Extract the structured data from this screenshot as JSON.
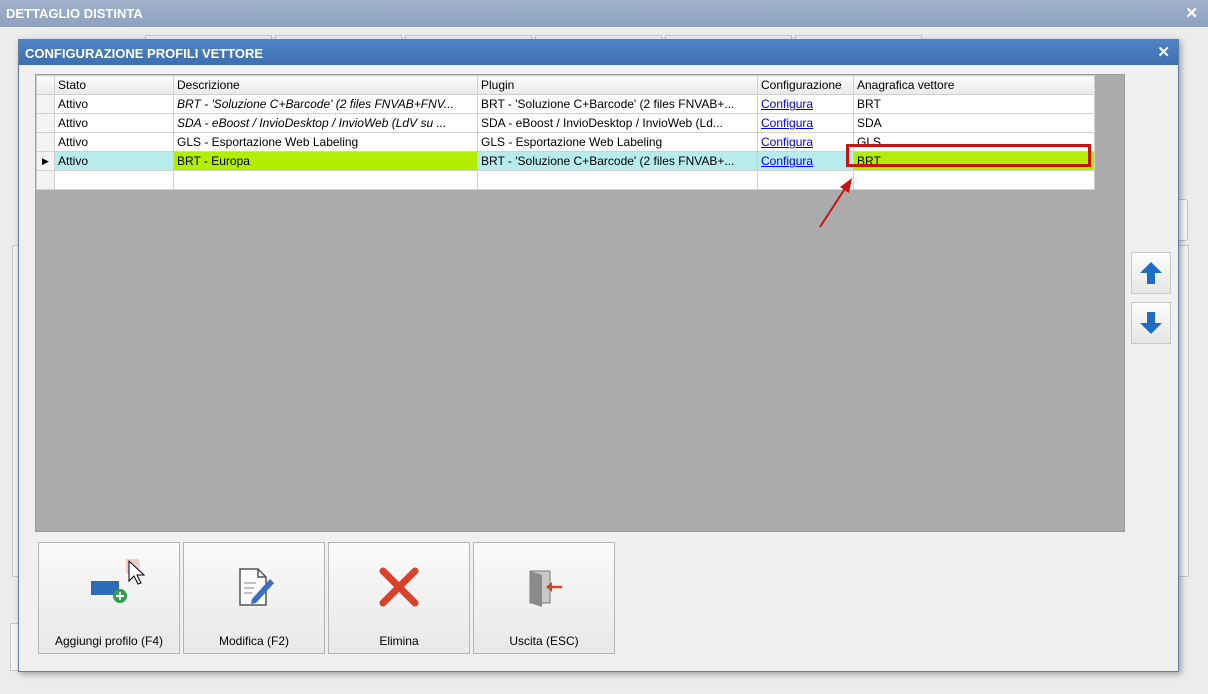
{
  "outer_window": {
    "title": "DETTAGLIO DISTINTA",
    "close": "✕"
  },
  "dialog": {
    "title": "CONFIGURAZIONE PROFILI VETTORE",
    "close": "✕",
    "grid": {
      "columns": [
        "Stato",
        "Descrizione",
        "Plugin",
        "Configurazione",
        "Anagrafica vettore"
      ],
      "rows": [
        {
          "stato": "Attivo",
          "descrizione": "BRT - 'Soluzione C+Barcode' (2 files FNVAB+FNV...",
          "plugin": "BRT - 'Soluzione C+Barcode' (2 files FNVAB+...",
          "config": "Configura",
          "anagrafica": "BRT"
        },
        {
          "stato": "Attivo",
          "descrizione": "SDA - eBoost / InvioDesktop / InvioWeb (LdV su ...",
          "plugin": "SDA - eBoost / InvioDesktop / InvioWeb (Ld...",
          "config": "Configura",
          "anagrafica": "SDA"
        },
        {
          "stato": "Attivo",
          "descrizione": "GLS - Esportazione Web Labeling",
          "plugin": "GLS - Esportazione Web Labeling",
          "config": "Configura",
          "anagrafica": "GLS"
        },
        {
          "stato": "Attivo",
          "descrizione": "BRT - Europa",
          "plugin": "BRT - 'Soluzione C+Barcode' (2 files FNVAB+...",
          "config": "Configura",
          "anagrafica": "BRT"
        }
      ],
      "current_row_marker": "▶"
    },
    "buttons": {
      "add": "Aggiungi profilo (F4)",
      "edit": "Modifica (F2)",
      "delete": "Elimina",
      "exit": "Uscita (ESC)"
    },
    "side_buttons": {
      "up": "arrow-up-icon",
      "down": "arrow-down-icon"
    }
  },
  "colors": {
    "title_bar": "#4a7ec0",
    "highlight_green": "#b3ee00",
    "current_row": "#b8ecec",
    "annotation_red": "#cc1111",
    "arrow_blue": "#1e6cc8"
  }
}
